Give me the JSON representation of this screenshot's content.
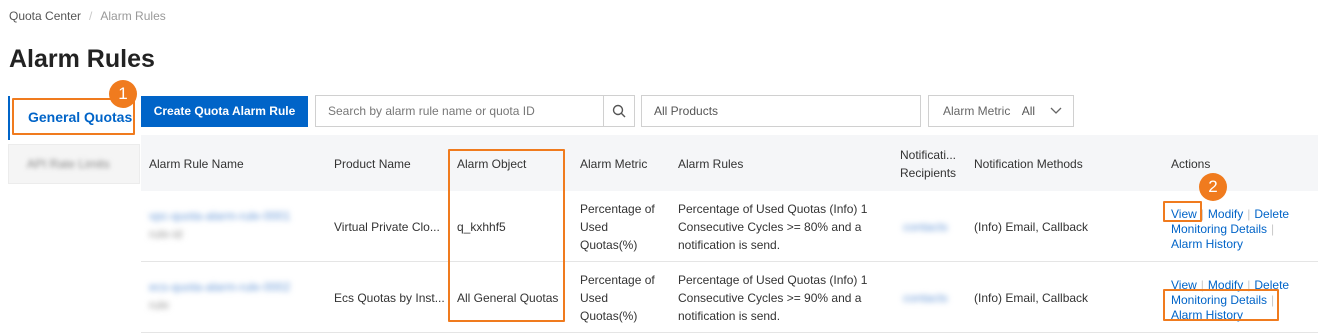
{
  "breadcrumb": {
    "root": "Quota Center",
    "separator": "/",
    "current": "Alarm Rules"
  },
  "page_title": "Alarm Rules",
  "tabs": {
    "active_label": "General Quotas",
    "inactive_label": "API Rate Limits"
  },
  "toolbar": {
    "create_label": "Create Quota Alarm Rule",
    "search_placeholder": "Search by alarm rule name or quota ID",
    "products_value": "All Products",
    "metric_label": "Alarm Metric",
    "metric_value": "All"
  },
  "annotations": {
    "badge1": "1",
    "badge2": "2"
  },
  "table": {
    "headers": {
      "name": "Alarm Rule Name",
      "product": "Product Name",
      "object": "Alarm Object",
      "metric": "Alarm Metric",
      "rules": "Alarm Rules",
      "recipients_line1": "Notificati...",
      "recipients_line2": "Recipients",
      "methods": "Notification Methods",
      "actions": "Actions"
    },
    "rows": [
      {
        "name": "vpc-quota-alarm-rule-0001",
        "name_sub": "rule-id",
        "product": "Virtual Private Clo...",
        "object": "q_kxhhf5",
        "metric_l1": "Percentage of",
        "metric_l2": "Used",
        "metric_l3": "Quotas(%)",
        "rule_l1": "Percentage of Used Quotas (Info) 1",
        "rule_l2": "Consecutive Cycles >= 80% and a",
        "rule_l3": "notification is send.",
        "recipients": "contacts",
        "methods": "(Info) Email, Callback",
        "actions": {
          "view": "View",
          "modify": "Modify",
          "delete": "Delete",
          "monitoring": "Monitoring Details",
          "history": "Alarm History"
        }
      },
      {
        "name": "ecs-quota-alarm-rule-0002",
        "name_sub": "rule",
        "product": "Ecs Quotas by Inst...",
        "object": "All General Quotas",
        "metric_l1": "Percentage of",
        "metric_l2": "Used",
        "metric_l3": "Quotas(%)",
        "rule_l1": "Percentage of Used Quotas (Info) 1",
        "rule_l2": "Consecutive Cycles >= 90% and a",
        "rule_l3": "notification is send.",
        "recipients": "contacts",
        "methods": "(Info) Email, Callback",
        "actions": {
          "view": "View",
          "modify": "Modify",
          "delete": "Delete",
          "monitoring": "Monitoring Details",
          "history": "Alarm History"
        }
      }
    ]
  },
  "colors": {
    "accent": "#0064c8",
    "highlight": "#f07b1e"
  }
}
